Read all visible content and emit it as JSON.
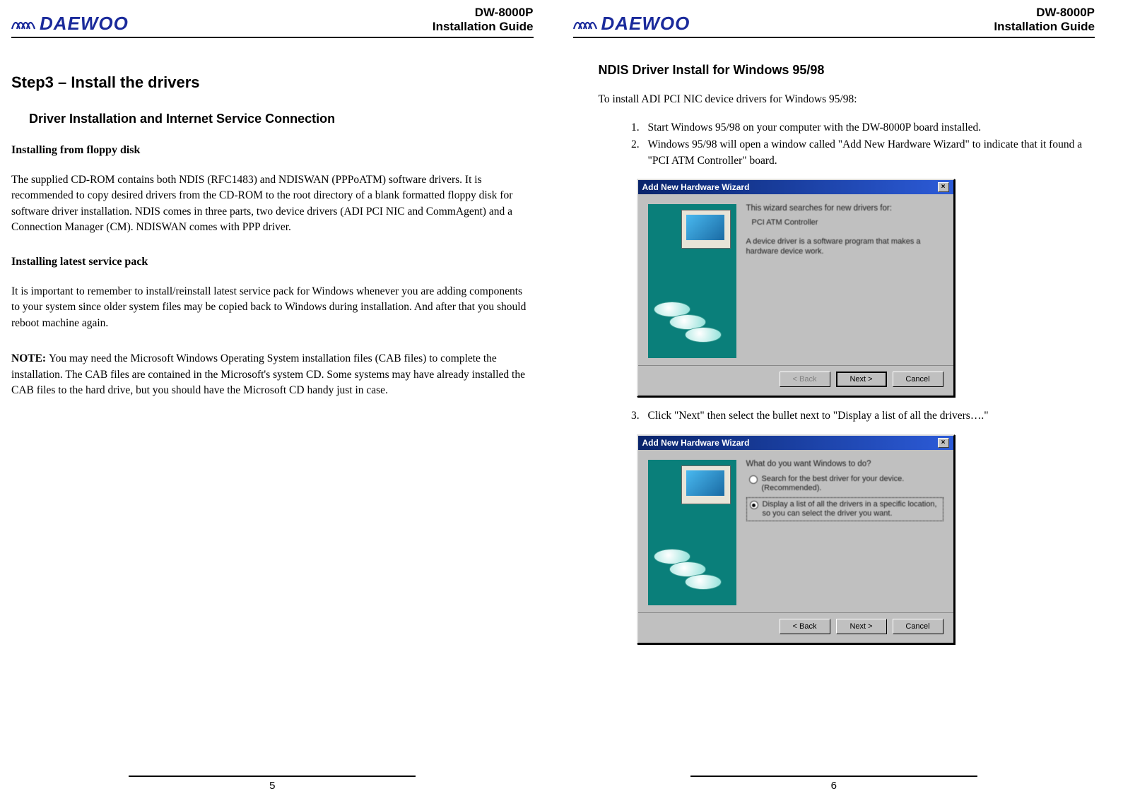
{
  "brand": "DAEWOO",
  "doc_title_line1": "DW-8000P",
  "doc_title_line2": "Installation Guide",
  "page5": {
    "number": "5",
    "h1": "Step3 – Install the drivers",
    "h2": "Driver Installation and Internet Service Connection",
    "sec1_title": "Installing from floppy disk",
    "sec1_body": "The supplied CD-ROM contains both NDIS (RFC1483) and NDISWAN (PPPoATM) software drivers. It is recommended to copy desired drivers from the CD-ROM to the root directory of a blank formatted floppy disk for software driver installation. NDIS comes in three parts, two device drivers (ADI PCI NIC and CommAgent) and a Connection Manager (CM). NDISWAN comes with PPP driver.",
    "sec2_title": "Installing latest service pack",
    "sec2_body": "It is important to remember to install/reinstall latest service pack for Windows whenever you are adding components to your system since older system files may be copied back to Windows during installation. And after that you should reboot machine again.",
    "note_label": "NOTE: ",
    "note_body": "You may need the Microsoft Windows Operating System installation files (CAB files) to complete the installation.  The CAB files are contained in the Microsoft's system CD.  Some systems may have already installed the CAB files to the hard drive, but you should have the Microsoft CD handy just in case."
  },
  "page6": {
    "number": "6",
    "h3": "NDIS Driver Install for Windows 95/98",
    "intro": "To install ADI PCI NIC device drivers for Windows 95/98:",
    "step1": "Start Windows 95/98 on your computer with the DW-8000P board installed.",
    "step2": "Windows 95/98 will open a window called \"Add New Hardware Wizard\" to indicate that it found a \"PCI ATM Controller\" board.",
    "step3": "Click \"Next\" then select the bullet next to \"Display a list of all the drivers….\"",
    "wizard1": {
      "title": "Add New Hardware Wizard",
      "prompt": "This wizard searches for new drivers for:",
      "device": "PCI ATM Controller",
      "desc": "A device driver is a software program that makes a hardware device work.",
      "back": "< Back",
      "next": "Next >",
      "cancel": "Cancel"
    },
    "wizard2": {
      "title": "Add New Hardware Wizard",
      "prompt": "What do you want Windows to do?",
      "opt1": "Search for the best driver for your device. (Recommended).",
      "opt2": "Display a list of all the drivers in a specific location, so you can select the driver you want.",
      "back": "< Back",
      "next": "Next >",
      "cancel": "Cancel"
    }
  }
}
